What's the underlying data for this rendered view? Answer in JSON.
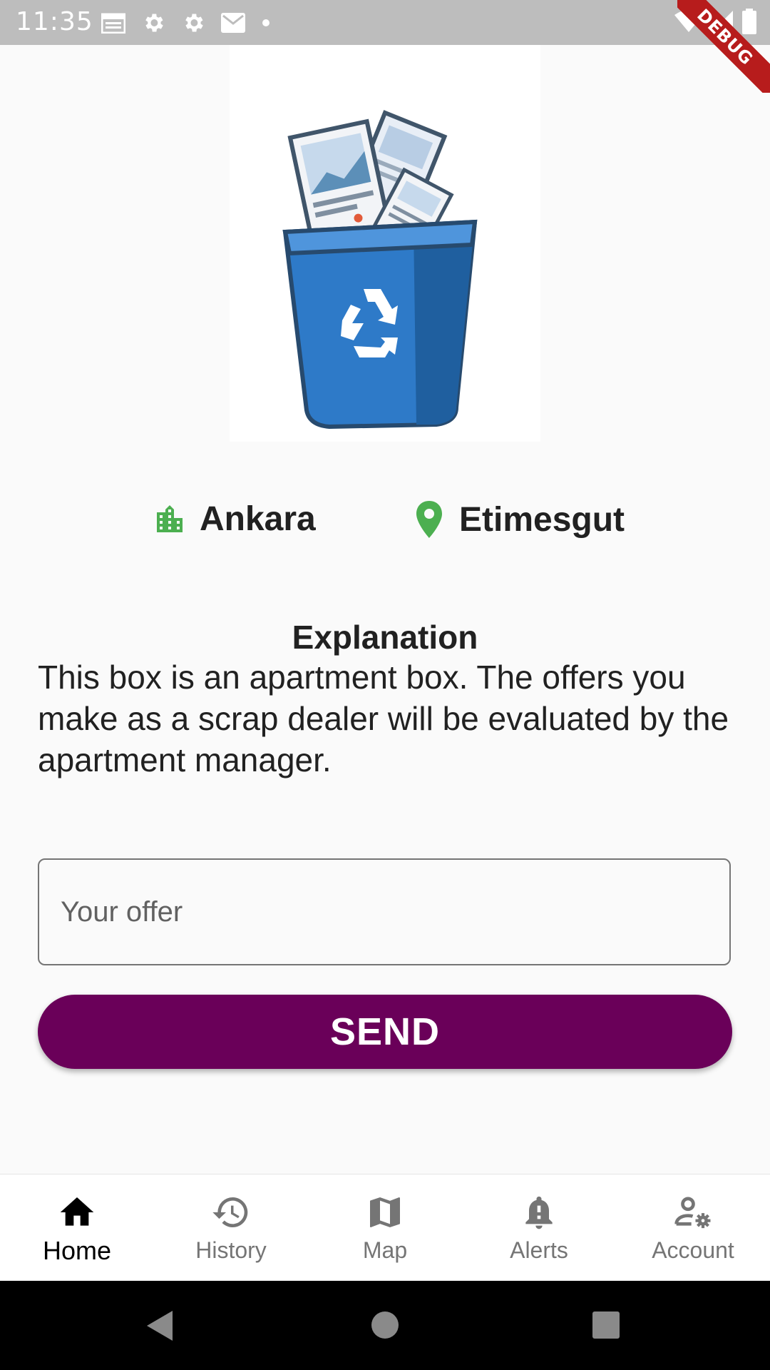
{
  "status_bar": {
    "time": "11:35"
  },
  "debug_banner": "DEBUG",
  "location": {
    "city": "Ankara",
    "district": "Etimesgut"
  },
  "explanation": {
    "title": "Explanation",
    "body": "This box is an apartment box. The offers you make as a scrap dealer will be evaluated by the apartment manager."
  },
  "offer": {
    "placeholder": "Your offer",
    "value": ""
  },
  "send_label": "SEND",
  "bottom_nav": {
    "items": [
      {
        "label": "Home",
        "icon": "home-icon",
        "active": true
      },
      {
        "label": "History",
        "icon": "history-icon",
        "active": false
      },
      {
        "label": "Map",
        "icon": "map-icon",
        "active": false
      },
      {
        "label": "Alerts",
        "icon": "bell-icon",
        "active": false
      },
      {
        "label": "Account",
        "icon": "account-settings-icon",
        "active": false
      }
    ]
  },
  "colors": {
    "accent": "#6a0059",
    "location_icon": "#4caf50",
    "status_bar": "#bdbdbd"
  }
}
